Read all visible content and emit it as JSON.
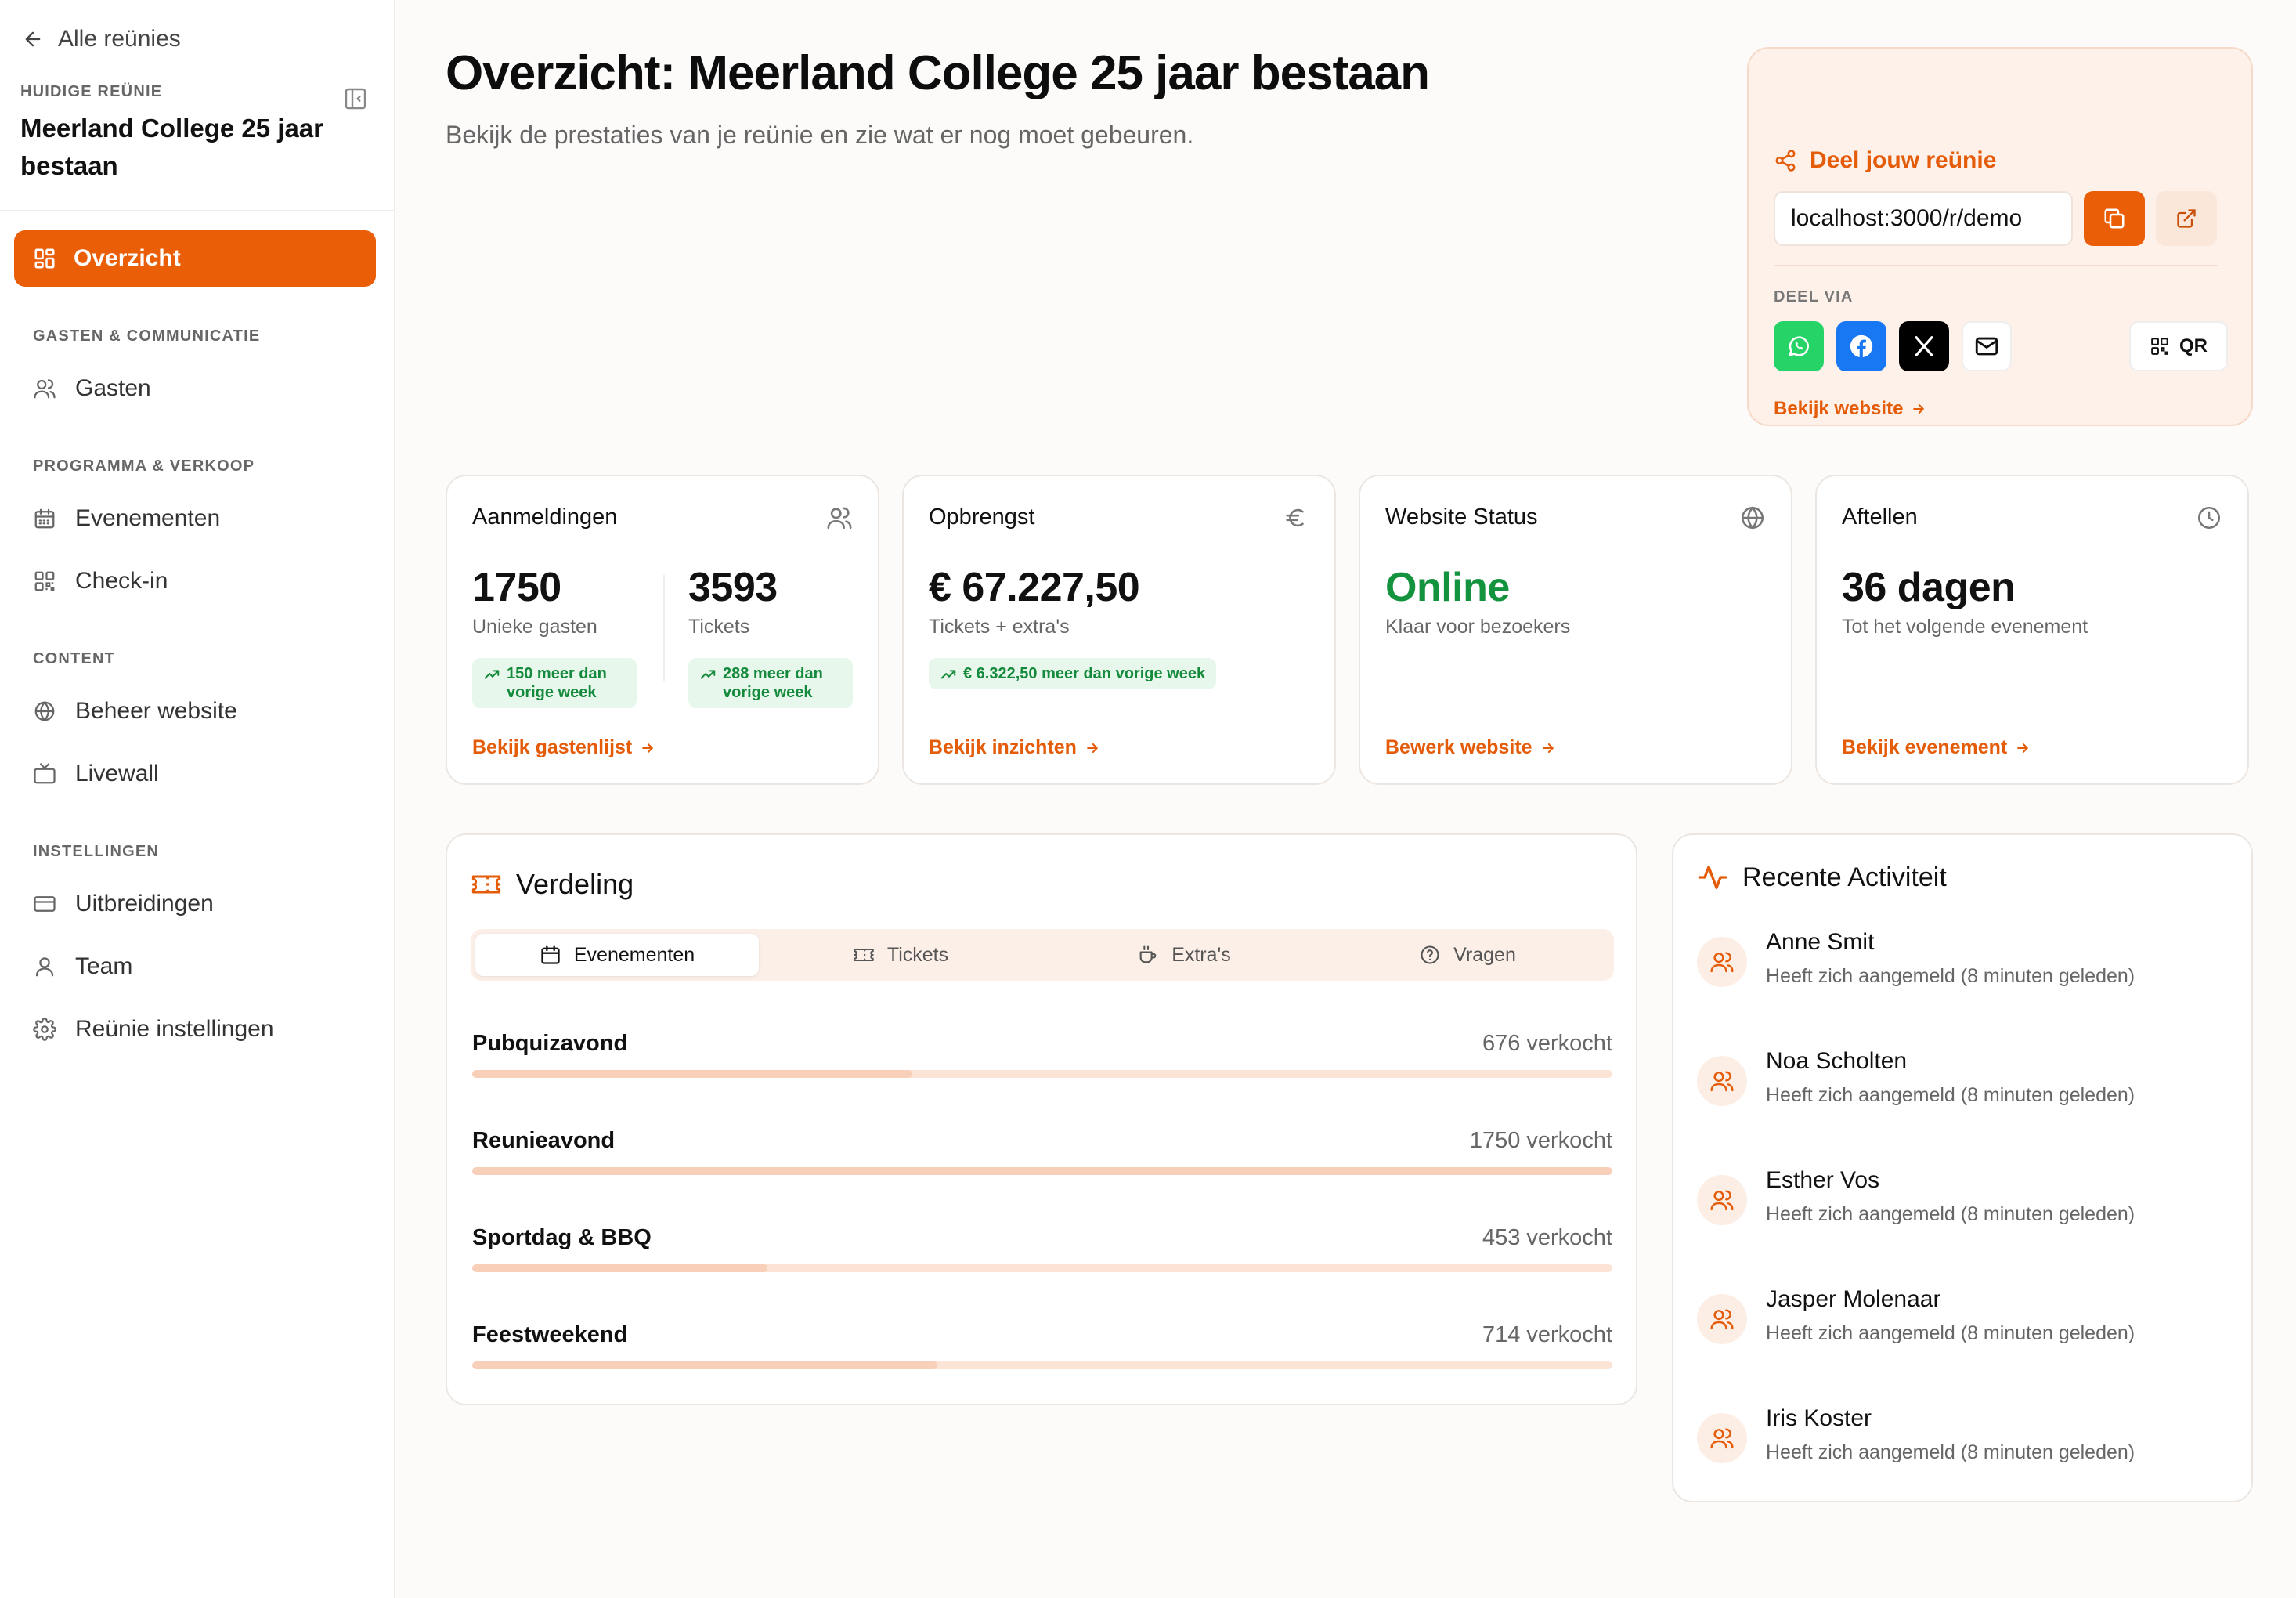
{
  "sidebar": {
    "back_label": "Alle reünies",
    "current_label": "HUIDIGE REÜNIE",
    "current_name": "Meerland College 25 jaar bestaan",
    "active_item": "Overzicht",
    "sections": [
      {
        "title": "GASTEN & COMMUNICATIE",
        "items": [
          "Gasten"
        ]
      },
      {
        "title": "PROGRAMMA & VERKOOP",
        "items": [
          "Evenementen",
          "Check-in"
        ]
      },
      {
        "title": "CONTENT",
        "items": [
          "Beheer website",
          "Livewall"
        ]
      },
      {
        "title": "INSTELLINGEN",
        "items": [
          "Uitbreidingen",
          "Team",
          "Reünie instellingen"
        ]
      }
    ]
  },
  "header": {
    "title": "Overzicht: Meerland College 25 jaar bestaan",
    "subtitle": "Bekijk de prestaties van je reünie en zie wat er nog moet gebeuren."
  },
  "share": {
    "title": "Deel jouw reünie",
    "url": "localhost:3000/r/demo",
    "via_label": "DEEL VIA",
    "qr_label": "QR",
    "website_link": "Bekijk website"
  },
  "stats": {
    "aanmeldingen": {
      "title": "Aanmeldingen",
      "guests_value": "1750",
      "guests_label": "Unieke gasten",
      "guests_badge": "150 meer dan vorige week",
      "tickets_value": "3593",
      "tickets_label": "Tickets",
      "tickets_badge": "288 meer dan vorige week",
      "link": "Bekijk gastenlijst"
    },
    "opbrengst": {
      "title": "Opbrengst",
      "value": "€ 67.227,50",
      "label": "Tickets + extra's",
      "badge": "€ 6.322,50 meer dan vorige week",
      "link": "Bekijk inzichten"
    },
    "website": {
      "title": "Website Status",
      "value": "Online",
      "label": "Klaar voor bezoekers",
      "link": "Bewerk website"
    },
    "aftellen": {
      "title": "Aftellen",
      "value": "36 dagen",
      "label": "Tot het volgende evenement",
      "link": "Bekijk evenement"
    }
  },
  "distribution": {
    "title": "Verdeling",
    "tabs": [
      "Evenementen",
      "Tickets",
      "Extra's",
      "Vragen"
    ],
    "active_tab": "Evenementen",
    "rows": [
      {
        "name": "Pubquizavond",
        "label": "676 verkocht",
        "sold": 676
      },
      {
        "name": "Reunieavond",
        "label": "1750 verkocht",
        "sold": 1750
      },
      {
        "name": "Sportdag & BBQ",
        "label": "453 verkocht",
        "sold": 453
      },
      {
        "name": "Feestweekend",
        "label": "714 verkocht",
        "sold": 714
      }
    ]
  },
  "activity": {
    "title": "Recente Activiteit",
    "items": [
      {
        "name": "Anne Smit",
        "desc": "Heeft zich aangemeld (8 minuten geleden)"
      },
      {
        "name": "Noa Scholten",
        "desc": "Heeft zich aangemeld (8 minuten geleden)"
      },
      {
        "name": "Esther Vos",
        "desc": "Heeft zich aangemeld (8 minuten geleden)"
      },
      {
        "name": "Jasper Molenaar",
        "desc": "Heeft zich aangemeld (8 minuten geleden)"
      },
      {
        "name": "Iris Koster",
        "desc": "Heeft zich aangemeld (8 minuten geleden)"
      }
    ]
  },
  "colors": {
    "accent": "#ea5e08",
    "online": "#14933e",
    "badge_bg": "#e8f7ec",
    "whatsapp": "#25d366",
    "facebook": "#1877f2"
  }
}
